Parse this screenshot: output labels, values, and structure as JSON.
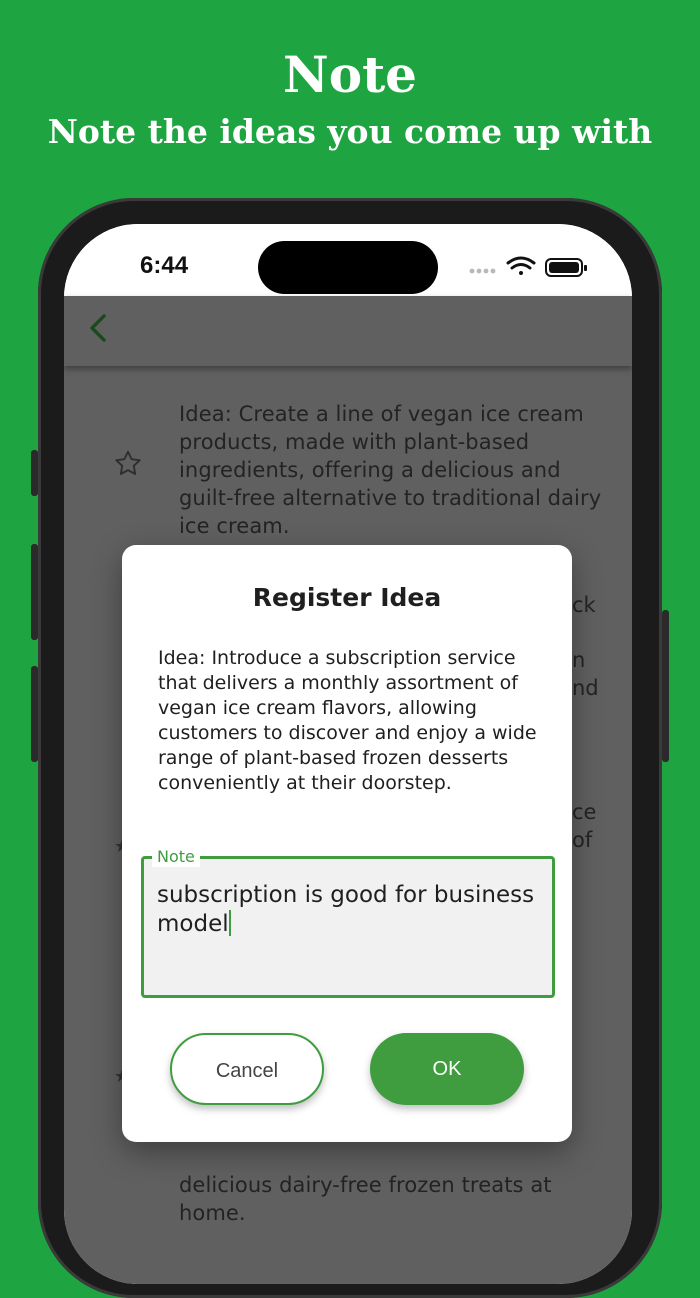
{
  "promo": {
    "title": "Note",
    "subtitle": "Note the ideas you come up with"
  },
  "status_bar": {
    "time": "6:44",
    "icons": [
      "signal-icon",
      "wifi-icon",
      "battery-icon"
    ]
  },
  "app_bar": {
    "back_icon": "chevron-left-icon"
  },
  "list": {
    "item1": {
      "text": "Idea: Create a line of vegan ice cream products, made with plant-based ingredients, offering a delicious and guilt-free alternative to traditional dairy ice cream.",
      "starred": false
    },
    "fragments": [
      "ck",
      "n",
      "nd",
      "ce",
      "of"
    ],
    "last_item_text": "delicious dairy-free frozen treats at home."
  },
  "dialog": {
    "title": "Register Idea",
    "body": "Idea: Introduce a subscription service that delivers a monthly assortment of vegan ice cream flavors, allowing customers to discover and enjoy a wide range of plant-based frozen desserts conveniently at their doorstep.",
    "note_label": "Note",
    "note_value": "subscription is good for business model",
    "cancel_label": "Cancel",
    "ok_label": "OK"
  },
  "colors": {
    "background": "#1ea541",
    "accent": "#3f9d3f",
    "scrim": "#606060",
    "text": "#1f1f1f"
  }
}
